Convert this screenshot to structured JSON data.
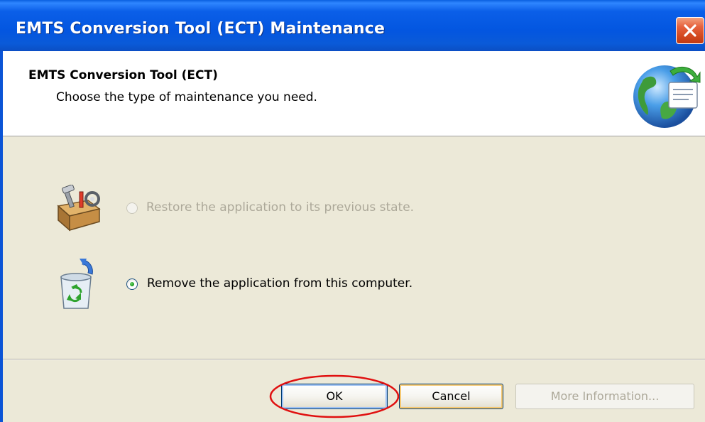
{
  "window": {
    "title": "EMTS Conversion Tool (ECT) Maintenance",
    "close_icon": "close-icon"
  },
  "header": {
    "title": "EMTS Conversion Tool (ECT)",
    "subtitle": "Choose the type of maintenance you need.",
    "icon": "globe-document-icon"
  },
  "options": [
    {
      "label": "Restore the application to its previous state.",
      "selected": false,
      "enabled": false,
      "icon": "toolbox-icon"
    },
    {
      "label": "Remove the application from this computer.",
      "selected": true,
      "enabled": true,
      "icon": "recycle-bin-icon"
    }
  ],
  "buttons": {
    "ok_label": "OK",
    "cancel_label": "Cancel",
    "more_info_label": "More Information..."
  },
  "colors": {
    "title_bar": "#0356e0",
    "dialog_background": "#ece9d8",
    "close_button": "#d44a20",
    "highlight_annotation": "#e01010"
  }
}
